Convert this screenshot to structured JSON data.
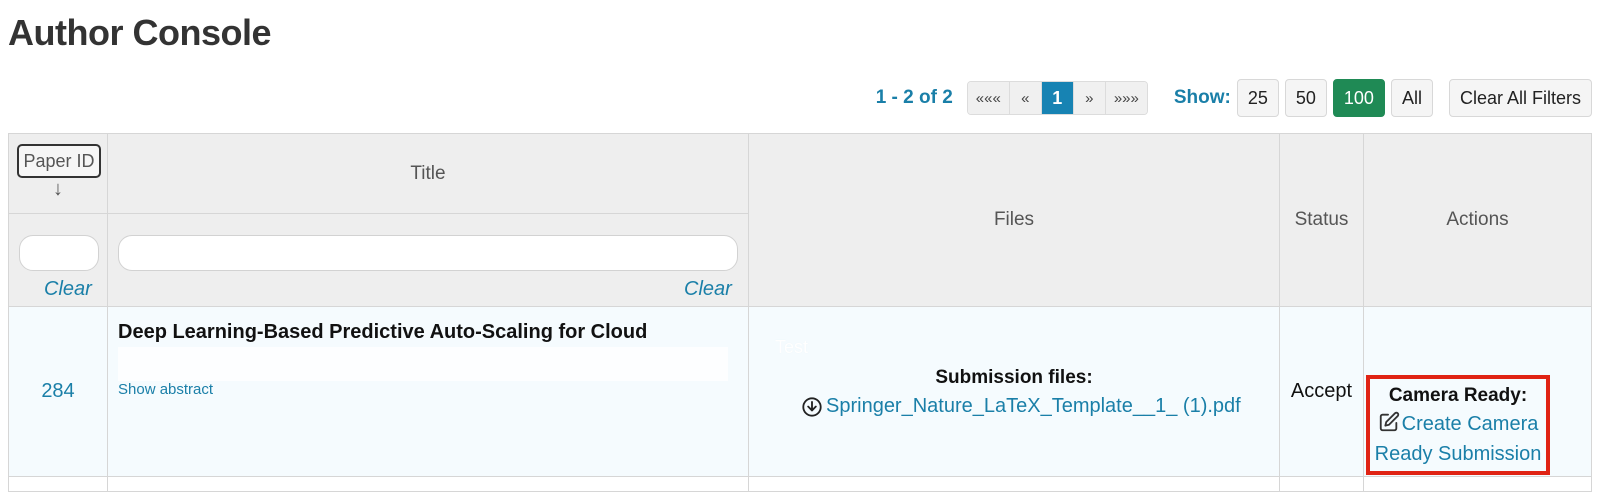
{
  "page": {
    "title": "Author Console"
  },
  "toolbar": {
    "range_text": "1 - 2 of 2",
    "pager": {
      "first": "«««",
      "prev": "«",
      "current": "1",
      "next": "»",
      "last": "»»»"
    },
    "show_label": "Show:",
    "page_sizes": [
      "25",
      "50",
      "100",
      "All"
    ],
    "active_page_size": "100",
    "clear_all_label": "Clear All Filters"
  },
  "table": {
    "headers": {
      "paper_id": "Paper ID",
      "sort_arrow": "↓",
      "title": "Title",
      "files": "Files",
      "status": "Status",
      "actions": "Actions"
    },
    "filters": {
      "paper_id_clear": "Clear",
      "title_clear": "Clear"
    },
    "rows": [
      {
        "paper_id": "284",
        "title": "Deep Learning-Based Predictive Auto-Scaling for Cloud",
        "show_abstract": "Show abstract",
        "ghost_text": "Test",
        "files_label": "Submission files:",
        "file_name": "Springer_Nature_LaTeX_Template__1_ (1).pdf",
        "status": "Accept",
        "camera_ready_label": "Camera Ready:",
        "camera_ready_link": "Create Camera Ready Submission"
      }
    ]
  },
  "colors": {
    "link": "#1a7fa8",
    "pager_active": "#1783b3",
    "size_active": "#1f8a55",
    "highlight_border": "#e02314"
  }
}
